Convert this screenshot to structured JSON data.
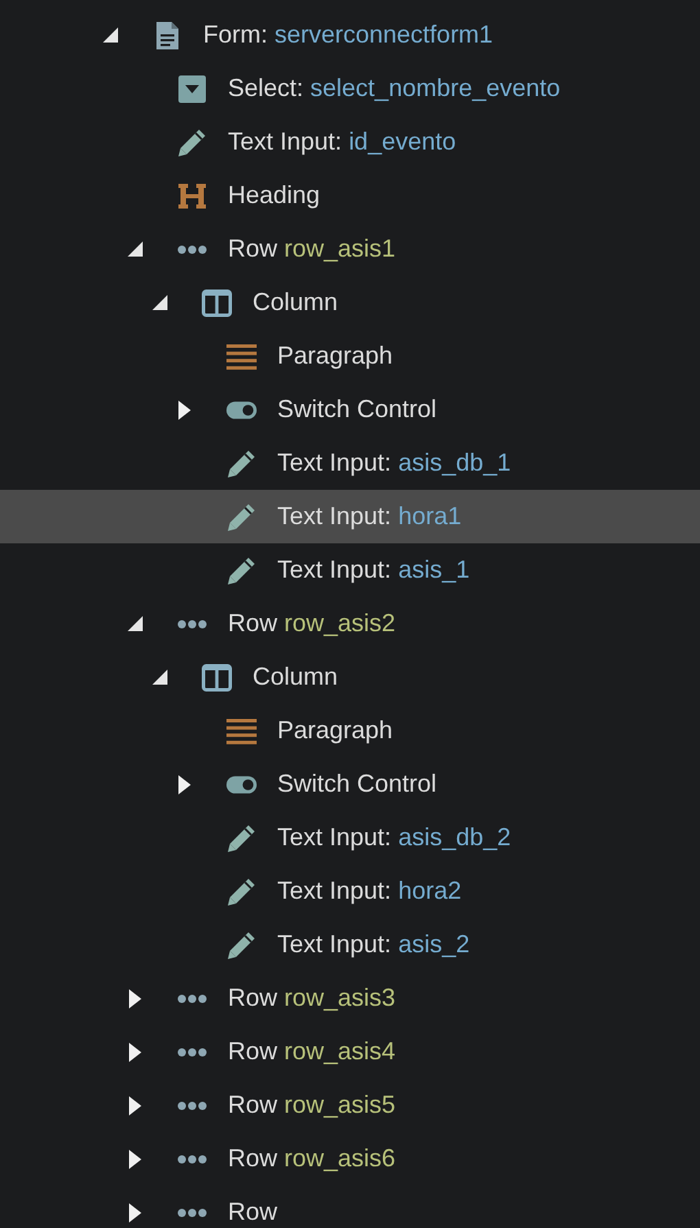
{
  "tree": [
    {
      "kind": "form",
      "label": "Form:",
      "name": "serverconnectform1",
      "expanded": true,
      "selected": false,
      "children": [
        {
          "kind": "select",
          "label": "Select:",
          "name": "select_nombre_evento",
          "selected": false
        },
        {
          "kind": "input",
          "label": "Text Input:",
          "name": "id_evento",
          "selected": false
        },
        {
          "kind": "heading",
          "label": "Heading",
          "selected": false
        },
        {
          "kind": "row",
          "label": "Row",
          "name": "row_asis1",
          "expanded": true,
          "selected": false,
          "children": [
            {
              "kind": "column",
              "label": "Column",
              "expanded": true,
              "selected": false,
              "children": [
                {
                  "kind": "paragraph",
                  "label": "Paragraph",
                  "selected": false
                },
                {
                  "kind": "switch",
                  "label": "Switch Control",
                  "expanded": false,
                  "selected": false
                },
                {
                  "kind": "input",
                  "label": "Text Input:",
                  "name": "asis_db_1",
                  "selected": false
                },
                {
                  "kind": "input",
                  "label": "Text Input:",
                  "name": "hora1",
                  "selected": true
                },
                {
                  "kind": "input",
                  "label": "Text Input:",
                  "name": "asis_1",
                  "selected": false
                }
              ]
            }
          ]
        },
        {
          "kind": "row",
          "label": "Row",
          "name": "row_asis2",
          "expanded": true,
          "selected": false,
          "children": [
            {
              "kind": "column",
              "label": "Column",
              "expanded": true,
              "selected": false,
              "children": [
                {
                  "kind": "paragraph",
                  "label": "Paragraph",
                  "selected": false
                },
                {
                  "kind": "switch",
                  "label": "Switch Control",
                  "expanded": false,
                  "selected": false
                },
                {
                  "kind": "input",
                  "label": "Text Input:",
                  "name": "asis_db_2",
                  "selected": false
                },
                {
                  "kind": "input",
                  "label": "Text Input:",
                  "name": "hora2",
                  "selected": false
                },
                {
                  "kind": "input",
                  "label": "Text Input:",
                  "name": "asis_2",
                  "selected": false
                }
              ]
            }
          ]
        },
        {
          "kind": "row",
          "label": "Row",
          "name": "row_asis3",
          "expanded": false,
          "selected": false
        },
        {
          "kind": "row",
          "label": "Row",
          "name": "row_asis4",
          "expanded": false,
          "selected": false
        },
        {
          "kind": "row",
          "label": "Row",
          "name": "row_asis5",
          "expanded": false,
          "selected": false
        },
        {
          "kind": "row",
          "label": "Row",
          "name": "row_asis6",
          "expanded": false,
          "selected": false
        },
        {
          "kind": "row",
          "label": "Row",
          "expanded": false,
          "selected": false
        }
      ]
    }
  ]
}
